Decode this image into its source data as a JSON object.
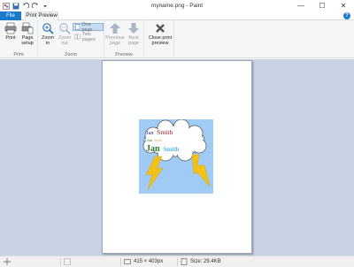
{
  "window": {
    "title": "myname.png - Paint",
    "controls": {
      "minimize": "—",
      "maximize": "☐",
      "close": "✕"
    }
  },
  "tabs": {
    "file": "File",
    "print_preview": "Print Preview",
    "help": "?"
  },
  "ribbon": {
    "print_group": {
      "label": "Print",
      "print": "Print",
      "page_setup": [
        "Page",
        "setup"
      ]
    },
    "zoom_group": {
      "label": "Zoom",
      "zoom_in": [
        "Zoom",
        "in"
      ],
      "zoom_out": [
        "Zoom",
        "out"
      ],
      "one_page": "One page",
      "two_pages": "Two pages"
    },
    "preview_group": {
      "label": "Preview",
      "previous_page": [
        "Previous",
        "page"
      ],
      "next_page": [
        "Next",
        "page"
      ]
    },
    "close_group": {
      "close_print_preview": [
        "Close print",
        "preview"
      ]
    }
  },
  "artwork": {
    "line1": {
      "first": "Jan",
      "last": "Smith"
    },
    "line2": {
      "first": "Jan",
      "last": "Smith"
    },
    "line3": {
      "first": "Jan",
      "last": "Smith"
    }
  },
  "status": {
    "dimensions": "415 × 403px",
    "size": "Size: 29.4KB"
  },
  "colors": {
    "accent": "#1979ca",
    "canvas": "#c9d3e5",
    "sky": "#9fcbf5",
    "bolt": "#f2c21b"
  }
}
